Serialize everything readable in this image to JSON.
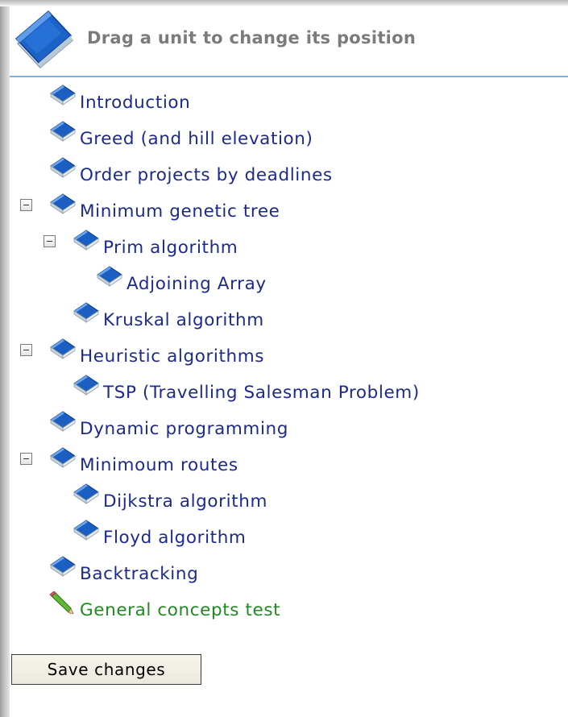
{
  "header": {
    "title": "Drag a unit to change its position",
    "icon": "blue-book-icon"
  },
  "tree": {
    "items": [
      {
        "label": "Introduction",
        "level": 0,
        "expanded": null,
        "icon": "book-icon"
      },
      {
        "label": "Greed (and hill elevation)",
        "level": 0,
        "expanded": null,
        "icon": "book-icon"
      },
      {
        "label": "Order projects by deadlines",
        "level": 0,
        "expanded": null,
        "icon": "book-icon"
      },
      {
        "label": "Minimum genetic tree",
        "level": 0,
        "expanded": true,
        "icon": "book-icon"
      },
      {
        "label": "Prim algorithm",
        "level": 1,
        "expanded": true,
        "icon": "book-icon"
      },
      {
        "label": "Adjoining Array",
        "level": 2,
        "expanded": null,
        "icon": "book-icon"
      },
      {
        "label": "Kruskal algorithm",
        "level": 1,
        "expanded": null,
        "icon": "book-icon"
      },
      {
        "label": "Heuristic algorithms",
        "level": 0,
        "expanded": true,
        "icon": "book-icon"
      },
      {
        "label": "TSP (Travelling Salesman Problem)",
        "level": 1,
        "expanded": null,
        "icon": "book-icon"
      },
      {
        "label": "Dynamic programming",
        "level": 0,
        "expanded": null,
        "icon": "book-icon"
      },
      {
        "label": "Minimoum routes",
        "level": 0,
        "expanded": true,
        "icon": "book-icon"
      },
      {
        "label": "Dijkstra algorithm",
        "level": 1,
        "expanded": null,
        "icon": "book-icon"
      },
      {
        "label": "Floyd algorithm",
        "level": 1,
        "expanded": null,
        "icon": "book-icon"
      },
      {
        "label": "Backtracking",
        "level": 0,
        "expanded": null,
        "icon": "book-icon"
      },
      {
        "label": "General concepts test",
        "level": 0,
        "expanded": null,
        "icon": "pencil-icon",
        "kind": "test"
      }
    ]
  },
  "actions": {
    "save_label": "Save changes"
  },
  "colors": {
    "unit_link": "#1c2a8c",
    "test_link": "#1f8a1f",
    "header_text": "#7b7b7b",
    "header_rule": "#7fb0e4"
  }
}
